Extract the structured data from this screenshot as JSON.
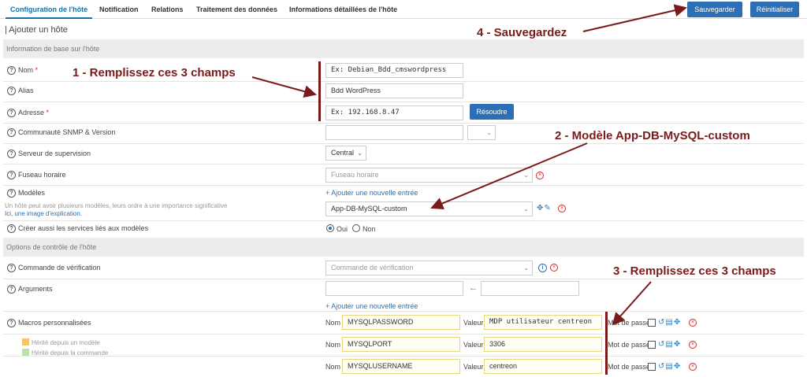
{
  "tabs": [
    "Configuration de l'hôte",
    "Notification",
    "Relations",
    "Traitement des données",
    "Informations détaillées de l'hôte"
  ],
  "buttons": {
    "save": "Sauvegarder",
    "reset": "Réinitialiser",
    "resolve": "Résoudre"
  },
  "page_title": "| Ajouter un hôte",
  "sections": {
    "basic": "Information de base sur l'hôte",
    "control": "Options de contrôle de l'hôte"
  },
  "fields": {
    "name": {
      "label": "Nom",
      "required": "*",
      "value": "Ex: Debian_Bdd_cmswordpress"
    },
    "alias": {
      "label": "Alias",
      "value": "Bdd WordPress"
    },
    "address": {
      "label": "Adresse",
      "required": "*",
      "value": "Ex: 192.168.8.47"
    },
    "snmp": {
      "label": "Communauté SNMP & Version"
    },
    "server": {
      "label": "Serveur de supervision",
      "value": "Central"
    },
    "timezone": {
      "label": "Fuseau horaire",
      "placeholder": "Fuseau horaire"
    },
    "templates": {
      "label": "Modèles",
      "add": "+ Ajouter une nouvelle entrée",
      "hint": "Un hôte peut avoir plusieurs modèles, leurs ordre à une importance significative",
      "link_pre": "Ici, une image d'explication.",
      "value": "App-DB-MySQL-custom"
    },
    "create_services": {
      "label": "Créer aussi les services liés aux modèles",
      "yes": "Oui",
      "no": "Non"
    },
    "check_command": {
      "label": "Commande de vérification",
      "placeholder": "Commande de vérification"
    },
    "arguments": {
      "label": "Arguments"
    },
    "macros": {
      "label": "Macros personnalisées",
      "add": "+ Ajouter une nouvelle entrée",
      "name_label": "Nom",
      "value_label": "Valeur",
      "password_label": "Mot de passe",
      "rows": [
        {
          "name": "MYSQLPASSWORD",
          "value": "MDP utilisateur centreon"
        },
        {
          "name": "MYSQLPORT",
          "value": "3306"
        },
        {
          "name": "MYSQLUSERNAME",
          "value": "centreon"
        }
      ],
      "legend_template": "Hérité depuis un modèle",
      "legend_command": "Hérité depuis la commande"
    }
  },
  "annotations": {
    "a1": "1 - Remplissez ces 3 champs",
    "a2": "2 - Modèle App-DB-MySQL-custom",
    "a3": "3 - Remplissez ces 3 champs",
    "a4": "4 - Sauvegardez"
  },
  "colors": {
    "primary": "#2c6fb7",
    "annotation": "#7a1a1a",
    "legend_template": "#f5c46b",
    "legend_command": "#b9e3a8"
  }
}
